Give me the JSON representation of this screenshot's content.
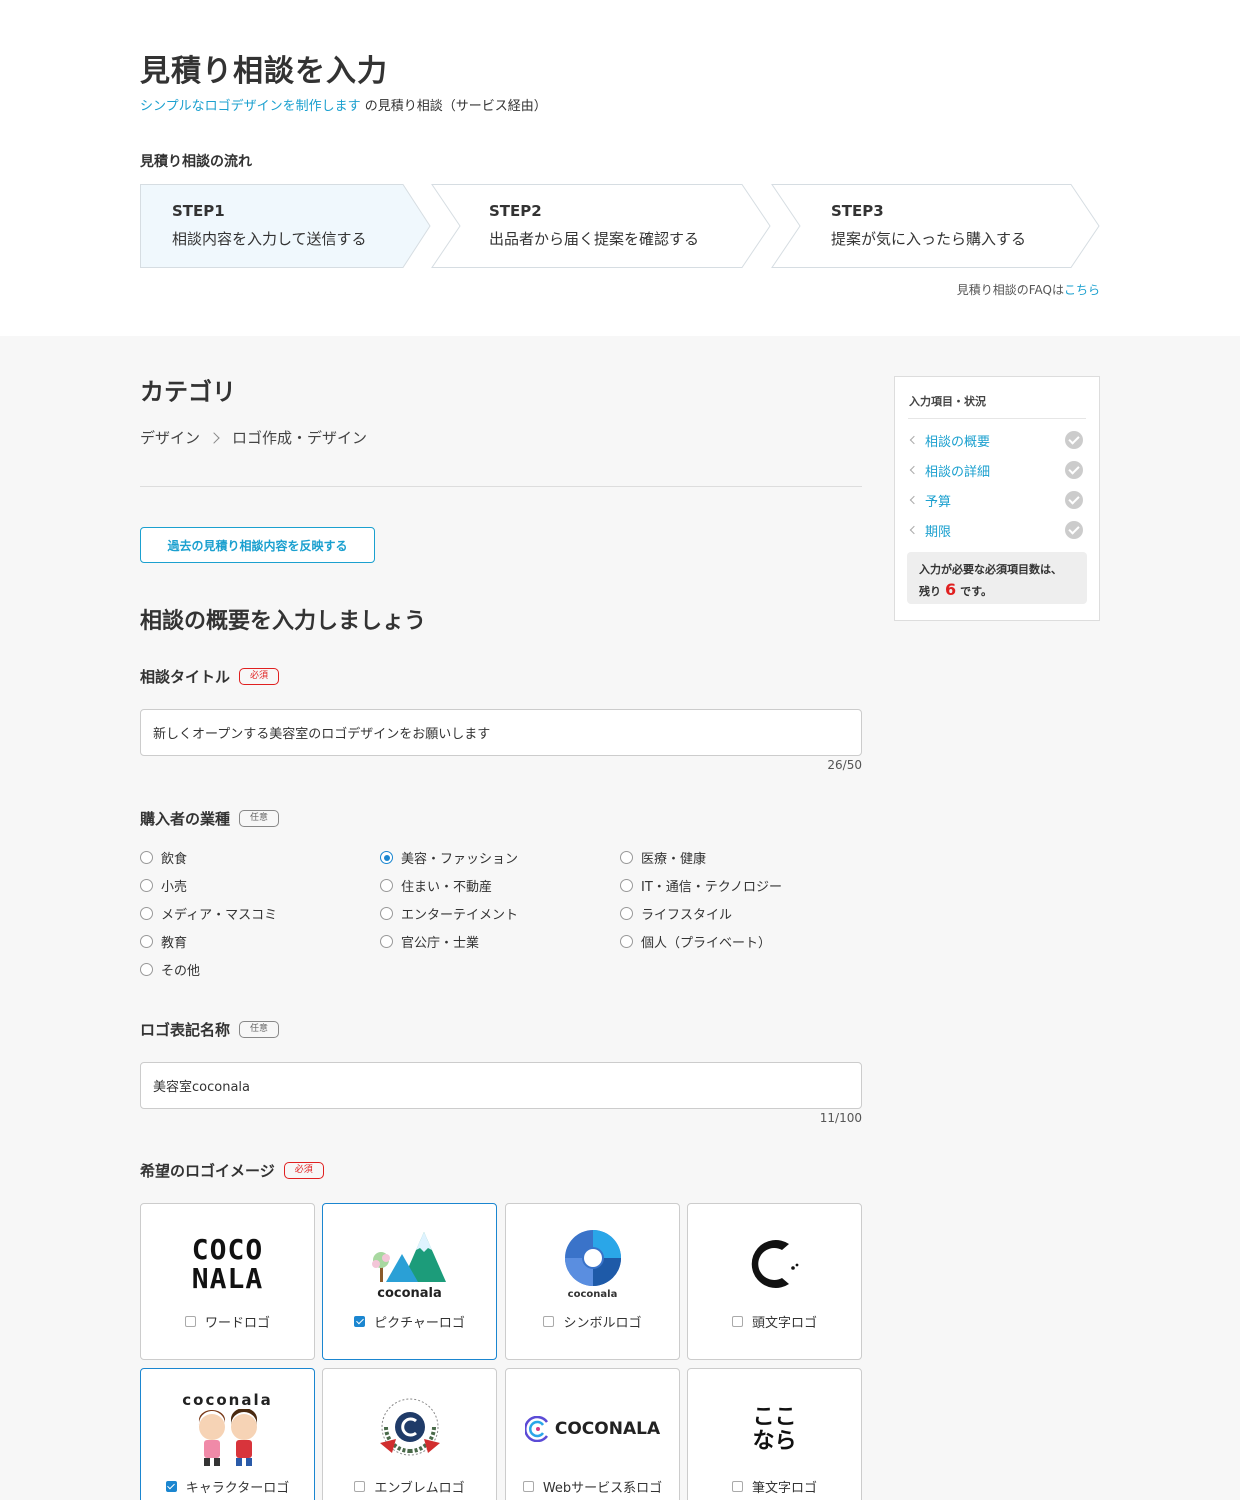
{
  "header": {
    "title": "見積り相談を入力",
    "service_link": "シンプルなロゴデザインを制作します",
    "subtitle_suffix": "の見積り相談（サービス経由）",
    "flow_title": "見積り相談の流れ",
    "steps": [
      {
        "num": "STEP1",
        "desc": "相談内容を入力して送信する"
      },
      {
        "num": "STEP2",
        "desc": "出品者から届く提案を確認する"
      },
      {
        "num": "STEP3",
        "desc": "提案が気に入ったら購入する"
      }
    ],
    "faq_text": "見積り相談のFAQは",
    "faq_link": "こちら"
  },
  "category": {
    "heading": "カテゴリ",
    "path": [
      "デザイン",
      "ロゴ作成・デザイン"
    ]
  },
  "past_button": "過去の見積り相談内容を反映する",
  "overview_heading": "相談の概要を入力しましょう",
  "fields": {
    "title": {
      "label": "相談タイトル",
      "badge": "必須",
      "value": "新しくオープンする美容室のロゴデザインをお願いします",
      "counter": "26/50"
    },
    "industry": {
      "label": "購入者の業種",
      "badge": "任意",
      "selected": "美容・ファッション",
      "options": [
        "飲食",
        "美容・ファッション",
        "医療・健康",
        "小売",
        "住まい・不動産",
        "IT・通信・テクノロジー",
        "メディア・マスコミ",
        "エンターテイメント",
        "ライフスタイル",
        "教育",
        "官公庁・士業",
        "個人（プライベート）",
        "その他"
      ]
    },
    "logo_name": {
      "label": "ロゴ表記名称",
      "badge": "任意",
      "value": "美容室coconala",
      "counter": "11/100"
    },
    "logo_image": {
      "label": "希望のロゴイメージ",
      "badge": "必須",
      "options": [
        {
          "label": "ワードロゴ",
          "checked": false,
          "art_lines": [
            "COCO",
            "NALA"
          ]
        },
        {
          "label": "ピクチャーロゴ",
          "checked": true,
          "art_lines": [
            "coconala"
          ]
        },
        {
          "label": "シンボルロゴ",
          "checked": false,
          "art_lines": [
            "coconala"
          ]
        },
        {
          "label": "頭文字ロゴ",
          "checked": false,
          "art_lines": []
        },
        {
          "label": "キャラクターロゴ",
          "checked": true,
          "art_lines": [
            "coconala"
          ]
        },
        {
          "label": "エンブレムロゴ",
          "checked": false,
          "art_lines": []
        },
        {
          "label": "Webサービス系ロゴ",
          "checked": false,
          "art_lines": [
            "COCONALA"
          ]
        },
        {
          "label": "筆文字ロゴ",
          "checked": false,
          "art_lines": [
            "ここ",
            "なら"
          ]
        }
      ]
    }
  },
  "sidebar": {
    "title": "入力項目・状況",
    "items": [
      "相談の概要",
      "相談の詳細",
      "予算",
      "期限"
    ],
    "remaining_prefix": "入力が必要な必須項目数は、",
    "remaining_mid": "残り",
    "remaining_count": "6",
    "remaining_suffix": "です。"
  },
  "colors": {
    "link": "#1ba0cf",
    "selected": "#1b86d0",
    "required": "#e02020",
    "step_active_bg": "#f0f8fd"
  }
}
